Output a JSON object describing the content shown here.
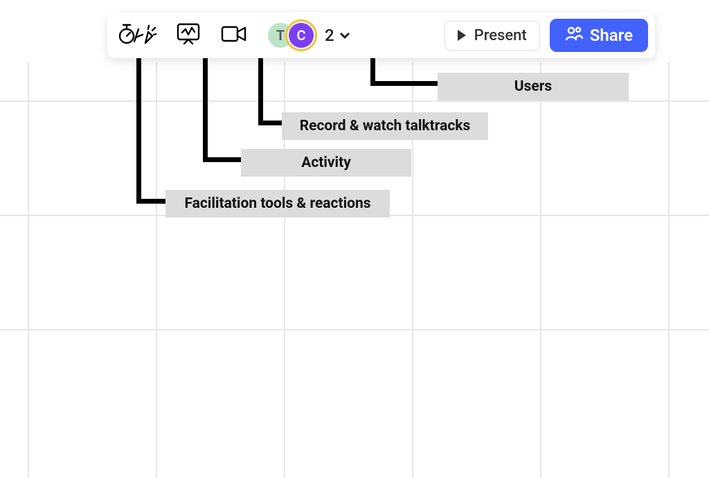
{
  "toolbar": {
    "icons": {
      "facilitation": "facilitation-tools-icon",
      "activity": "activity-icon",
      "talktrack": "video-camera-icon"
    },
    "avatars": [
      {
        "initial": "T",
        "bg": "#bde4c8",
        "fg": "#555555"
      },
      {
        "initial": "C",
        "bg": "#7b3ff2",
        "fg": "#ffffff"
      }
    ],
    "user_count": "2",
    "present_label": "Present",
    "share_label": "Share"
  },
  "callouts": {
    "users": "Users",
    "talktracks": "Record & watch talktracks",
    "activity": "Activity",
    "facilitation": "Facilitation tools & reactions"
  },
  "colors": {
    "share_bg": "#4262ff",
    "avatar_ring": "#f3c23c"
  }
}
